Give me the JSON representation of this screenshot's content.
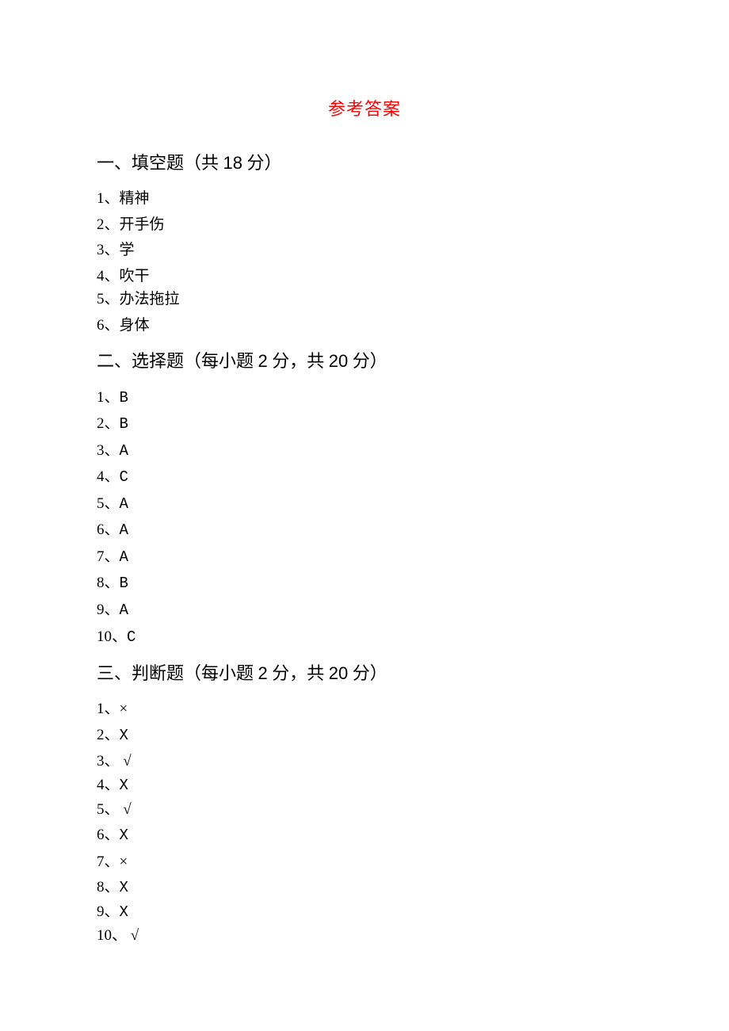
{
  "title": "参考答案",
  "sections": [
    {
      "heading_prefix": "一、填空题（共 ",
      "heading_num": "18",
      "heading_suffix": " 分）",
      "items": [
        {
          "idx": "1、",
          "val": "精神"
        },
        {
          "idx": "2、",
          "val": "开手伤"
        },
        {
          "idx": "3、",
          "val": "学"
        },
        {
          "idx": "4、",
          "val": "吹干"
        },
        {
          "idx": "5、",
          "val": "办法拖拉"
        },
        {
          "idx": "6、",
          "val": "身体"
        }
      ]
    },
    {
      "heading_prefix": "二、选择题（每小题 ",
      "heading_num": "2",
      "heading_mid": " 分，共 ",
      "heading_num2": "20",
      "heading_suffix": " 分）",
      "items": [
        {
          "idx": "1、",
          "val": "B"
        },
        {
          "idx": "2、",
          "val": "B"
        },
        {
          "idx": "3、",
          "val": "A"
        },
        {
          "idx": "4、",
          "val": "C"
        },
        {
          "idx": "5、",
          "val": "A"
        },
        {
          "idx": "6、",
          "val": "A"
        },
        {
          "idx": "7、",
          "val": "A"
        },
        {
          "idx": "8、",
          "val": "B"
        },
        {
          "idx": "9、",
          "val": "A"
        },
        {
          "idx": "10、",
          "val": "C"
        }
      ]
    },
    {
      "heading_prefix": "三、判断题（每小题 ",
      "heading_num": "2",
      "heading_mid": " 分，共 ",
      "heading_num2": "20",
      "heading_suffix": " 分）",
      "items": [
        {
          "idx": "1、",
          "val": "×"
        },
        {
          "idx": "2、",
          "val": "X"
        },
        {
          "idx": "3、 ",
          "val": "√"
        },
        {
          "idx": "4、",
          "val": "X"
        },
        {
          "idx": "5、 ",
          "val": "√"
        },
        {
          "idx": "6、",
          "val": "X"
        },
        {
          "idx": "7、",
          "val": "×"
        },
        {
          "idx": "8、",
          "val": "X"
        },
        {
          "idx": "9、",
          "val": "X"
        },
        {
          "idx": "10、 ",
          "val": "√"
        }
      ]
    }
  ]
}
